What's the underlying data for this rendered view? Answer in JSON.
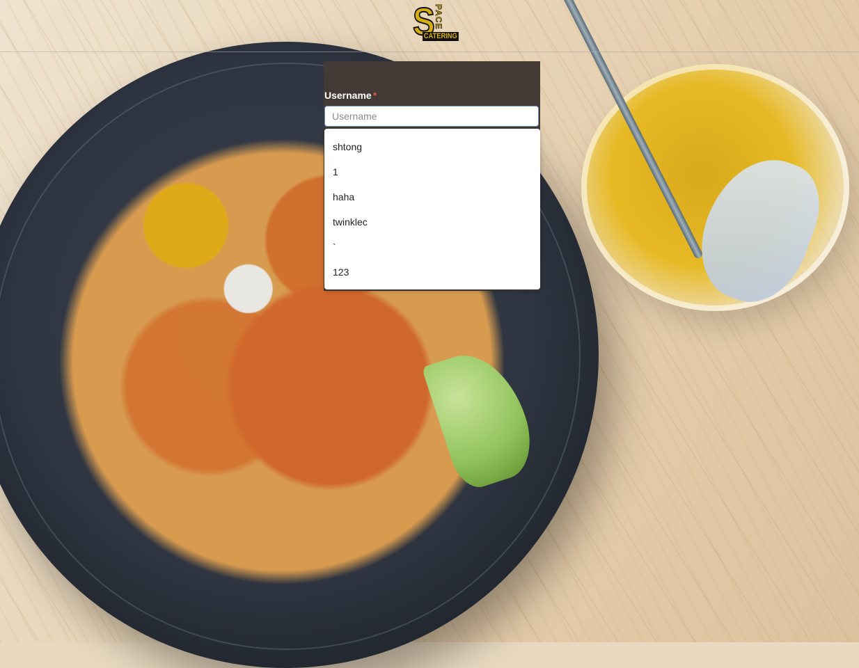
{
  "header": {
    "logo_alt": "Space Catering"
  },
  "login": {
    "username_label": "Username",
    "required_mark": "*",
    "username_placeholder": "Username",
    "username_value": ""
  },
  "autocomplete": {
    "options": [
      "shtong",
      "1",
      "haha",
      "twinklec",
      "`",
      "123"
    ]
  }
}
